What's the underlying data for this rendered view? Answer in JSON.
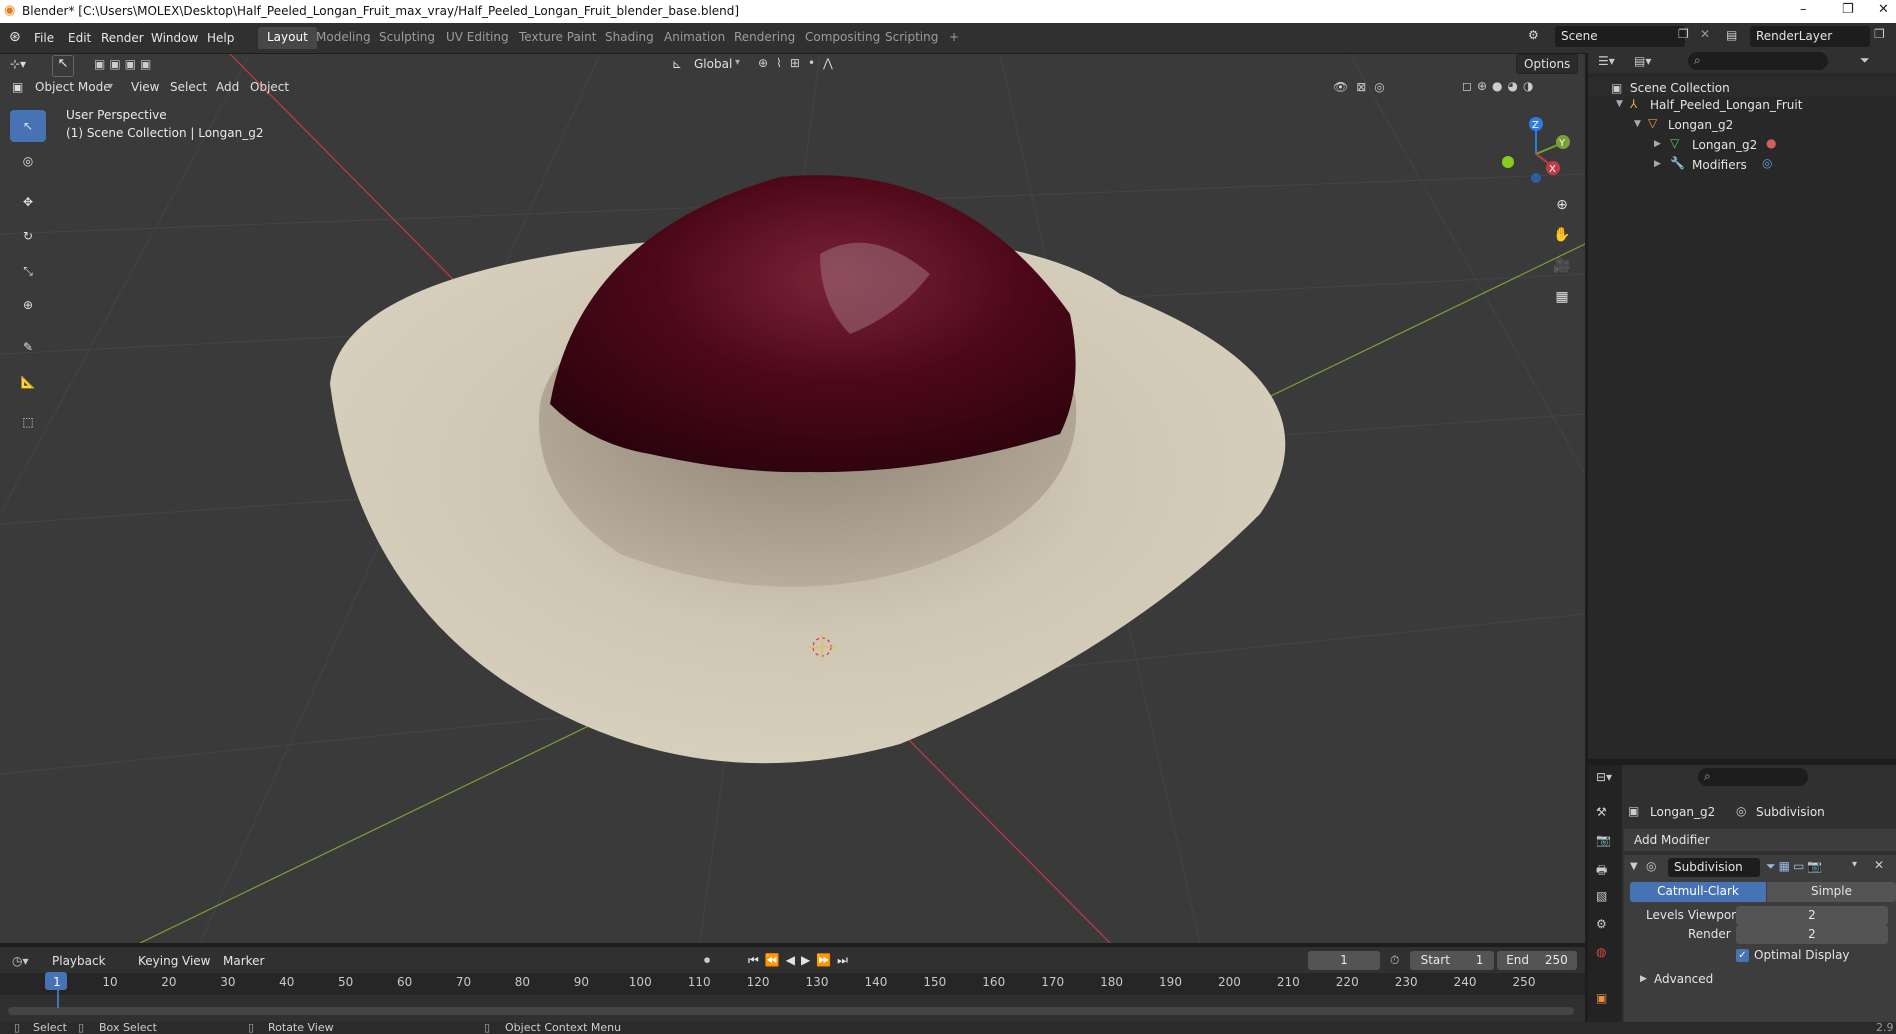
{
  "window": {
    "title": "Blender* [C:\\Users\\MOLEX\\Desktop\\Half_Peeled_Longan_Fruit_max_vray/Half_Peeled_Longan_Fruit_blender_base.blend]",
    "minimize": "–",
    "restore": "❐",
    "close": "✕"
  },
  "menu": [
    "File",
    "Edit",
    "Render",
    "Window",
    "Help"
  ],
  "workspaces": [
    "Layout",
    "Modeling",
    "Sculpting",
    "UV Editing",
    "Texture Paint",
    "Shading",
    "Animation",
    "Rendering",
    "Compositing",
    "Scripting"
  ],
  "workspace_add": "+",
  "scene": {
    "name": "Scene",
    "render_layer": "RenderLayer"
  },
  "viewport": {
    "transform_orientation": "Global",
    "options_label": "Options",
    "mode": "Object Mode",
    "header_menus": [
      "View",
      "Select",
      "Add",
      "Object"
    ],
    "overlay_line1": "User Perspective",
    "overlay_line2": "(1) Scene Collection | Longan_g2",
    "gizmo": {
      "x": "X",
      "y": "Y",
      "z": "Z"
    }
  },
  "outliner": {
    "root": "Scene Collection",
    "items": [
      {
        "label": "Half_Peeled_Longan_Fruit",
        "level": 1
      },
      {
        "label": "Longan_g2",
        "level": 2
      },
      {
        "label": "Longan_g2",
        "level": 3
      },
      {
        "label": "Modifiers",
        "level": 3
      }
    ]
  },
  "properties": {
    "object_name": "Longan_g2",
    "modifier_tab": "Subdivision",
    "add_modifier": "Add Modifier",
    "modifier_name": "Subdivision",
    "algo_options": [
      "Catmull-Clark",
      "Simple"
    ],
    "algo_selected": "Catmull-Clark",
    "levels_viewport_label": "Levels Viewport",
    "levels_viewport_value": "2",
    "render_label": "Render",
    "render_value": "2",
    "optimal_display_label": "Optimal Display",
    "optimal_display_checked": true,
    "advanced_label": "Advanced"
  },
  "timeline": {
    "menus": [
      "Playback",
      "Keying",
      "View",
      "Marker"
    ],
    "current_frame": "1",
    "start_label": "Start",
    "start_value": "1",
    "end_label": "End",
    "end_value": "250",
    "ticks": [
      "1",
      "10",
      "20",
      "30",
      "40",
      "50",
      "60",
      "70",
      "80",
      "90",
      "100",
      "110",
      "120",
      "130",
      "140",
      "150",
      "160",
      "170",
      "180",
      "190",
      "200",
      "210",
      "220",
      "230",
      "240",
      "250"
    ]
  },
  "status": {
    "select": "Select",
    "box_select": "Box Select",
    "rotate_view": "Rotate View",
    "context_menu": "Object Context Menu",
    "version": "2.9"
  },
  "colors": {
    "accent": "#4772b3",
    "x_axis": "#c23a46",
    "y_axis": "#7aa135",
    "z_axis": "#2f7de1",
    "pulp": "#cdc3b0",
    "seed": "#5a0a1c"
  }
}
